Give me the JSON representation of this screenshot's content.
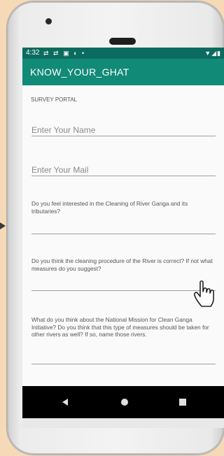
{
  "statusbar": {
    "time": "4:32",
    "notification_icons": "⇄ ⇄ ▣ ◐ •",
    "right_icons": "▼◢▮"
  },
  "appbar": {
    "title": "KNOW_YOUR_GHAT"
  },
  "form": {
    "section_label": "SURVEY PORTAL",
    "name_placeholder": "Enter Your Name",
    "mail_placeholder": "Enter Your Mail",
    "questions": [
      {
        "text": "Do you feel interested in the Cleaning of River Ganga and its tributaries?"
      },
      {
        "text": "Do you think the cleaning procedure of the River is correct? If not what measures do you suggest?"
      },
      {
        "text": "What do you think about the National Mission for Clean Ganga Initiative? Do you think that this type of measures should be taken for other rivers as well? If so, name those rivers."
      }
    ]
  },
  "colors": {
    "statusbar": "#0b6b5e",
    "appbar": "#128a78",
    "background": "#f6d9b6"
  },
  "icons": {
    "cursor": "hand-pointer-icon",
    "back": "back-triangle-icon",
    "home": "home-circle-icon",
    "recent": "recent-apps-square-icon"
  }
}
